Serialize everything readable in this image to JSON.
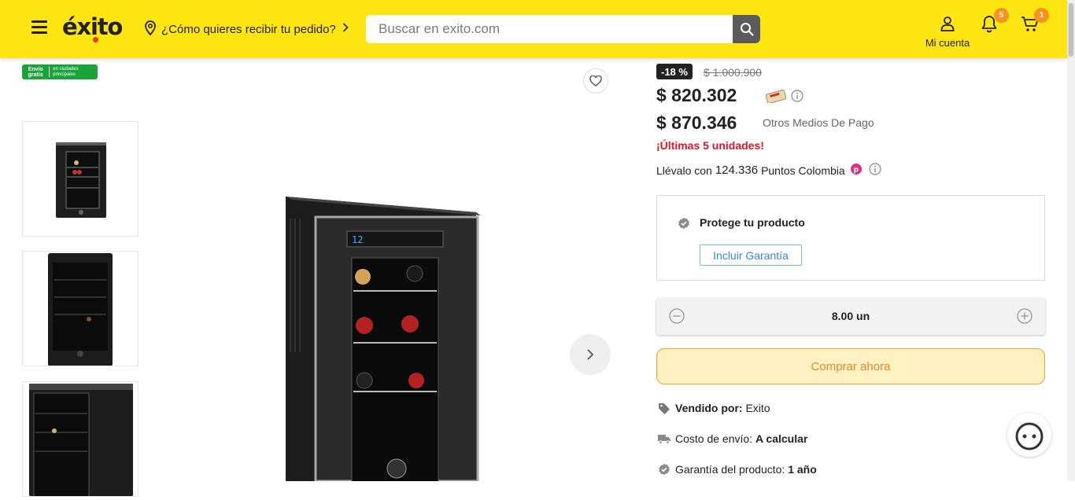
{
  "header": {
    "logo": "éxito",
    "location_prompt": "¿Cómo quieres recibir tu pedido?",
    "search_placeholder": "Buscar en exito.com",
    "account_label": "Mi cuenta",
    "notifications_count": "5",
    "cart_count": "1"
  },
  "gallery": {
    "free_shipping_main": "Envío gratis",
    "free_shipping_sub": "en ciudades principales"
  },
  "product": {
    "discount": "-18 %",
    "old_price": "$ 1.000.900",
    "price": "$ 820.302",
    "price_other": "$ 870.346",
    "price_other_label": "Otros Medios De Pago",
    "stock_alert": "¡Últimas 5 unidades!",
    "points_prefix": "Llévalo con",
    "points_value": "124.336",
    "points_suffix": "Puntos Colombia",
    "protect_title": "Protege tu producto",
    "protect_button": "Incluir Garantía",
    "quantity": "8.00 un",
    "buy_button": "Comprar ahora",
    "sold_by_label": "Vendido por:",
    "sold_by_value": "Exito",
    "shipping_label": "Costo de envío:",
    "shipping_value": "A calcular",
    "warranty_label": "Garantía del producto:",
    "warranty_value": "1 año"
  },
  "colors": {
    "header_bg": "#ffe512",
    "alert_red": "#e0162b",
    "buy_border": "#f1a336",
    "free_ship_green": "#1aa33b"
  }
}
